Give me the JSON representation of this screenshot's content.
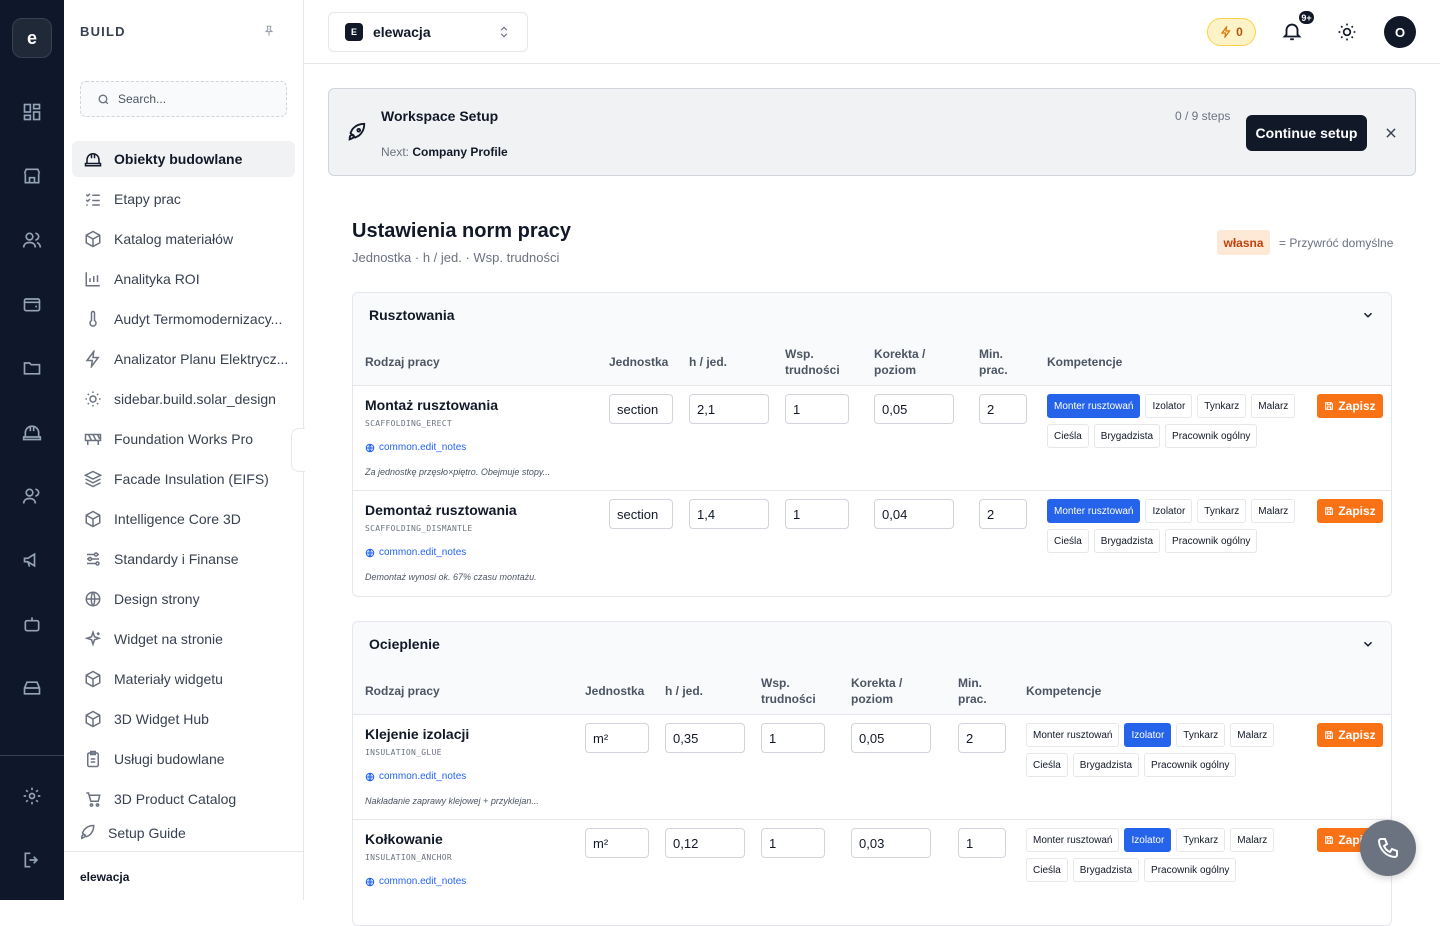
{
  "rail": {
    "logo_letter": "e",
    "icons": [
      "dashboard-icon",
      "store-icon",
      "users-icon",
      "wallet-icon",
      "folder-icon",
      "hardhat-icon",
      "team-icon",
      "megaphone-icon",
      "bot-icon",
      "drive-icon",
      "settings-icon",
      "logout-icon"
    ]
  },
  "sidebar": {
    "title": "BUILD",
    "search_placeholder": "Search...",
    "items": [
      {
        "label": "Obiekty budowlane",
        "icon": "hardhat-icon"
      },
      {
        "label": "Etapy prac",
        "icon": "checklist-icon"
      },
      {
        "label": "Katalog materiałów",
        "icon": "box-icon"
      },
      {
        "label": "Analityka ROI",
        "icon": "bar-chart-icon"
      },
      {
        "label": "Audyt Termomodernizacy...",
        "icon": "thermometer-icon"
      },
      {
        "label": "Analizator Planu Elektrycz...",
        "icon": "zap-icon"
      },
      {
        "label": "sidebar.build.solar_design",
        "icon": "sun-icon"
      },
      {
        "label": "Foundation Works Pro",
        "icon": "construction-icon"
      },
      {
        "label": "Facade Insulation (EIFS)",
        "icon": "layers-icon"
      },
      {
        "label": "Intelligence Core 3D",
        "icon": "box-icon"
      },
      {
        "label": "Standardy i Finanse",
        "icon": "sliders-icon"
      },
      {
        "label": "Design strony",
        "icon": "globe-icon"
      },
      {
        "label": "Widget na stronie",
        "icon": "sparkles-icon"
      },
      {
        "label": "Materiały widgetu",
        "icon": "box-icon"
      },
      {
        "label": "3D Widget Hub",
        "icon": "box-icon"
      },
      {
        "label": "Usługi budowlane",
        "icon": "clipboard-icon"
      },
      {
        "label": "3D Product Catalog",
        "icon": "cart-icon"
      },
      {
        "label": "Setup Guide",
        "icon": "rocket-icon"
      }
    ],
    "workspace": "elewacja"
  },
  "topbar": {
    "workspace_badge": "E",
    "workspace_name": "elewacja",
    "credits": "0",
    "notifications": "9+",
    "avatar": "O"
  },
  "setup": {
    "title": "Workspace Setup",
    "next_label": "Next:",
    "next_value": "Company Profile",
    "steps": "0 / 9 steps",
    "button": "Continue setup"
  },
  "page": {
    "title": "Ustawienia norm pracy",
    "subtitle": "Jednostka · h / jed. · Wsp. trudności",
    "legend_chip": "własna",
    "legend_text": "= Przywróć domyślne"
  },
  "columns": {
    "name": "Rodzaj pracy",
    "unit": "Jednostka",
    "h": "h / jed.",
    "difficulty": [
      "Wsp.",
      "trudności"
    ],
    "correction": [
      "Korekta /",
      "poziom"
    ],
    "min": [
      "Min.",
      "prac."
    ],
    "skills": "Kompetencje"
  },
  "skills": [
    "Monter rusztowań",
    "Izolator",
    "Tynkarz",
    "Malarz",
    "Cieśla",
    "Brygadzista",
    "Pracownik ogólny"
  ],
  "save_label": "Zapisz",
  "notes_link": "common.edit_notes",
  "sections": [
    {
      "title": "Rusztowania",
      "rows": [
        {
          "name": "Montaż rusztowania",
          "code": "SCAFFOLDING_ERECT",
          "unit": "section",
          "h": "2,1",
          "difficulty": "1",
          "correction": "0,05",
          "min": "2",
          "active_skill": "Monter rusztowań",
          "note": "Za jednostkę przęsło×piętro. Obejmuje stopy..."
        },
        {
          "name": "Demontaż rusztowania",
          "code": "SCAFFOLDING_DISMANTLE",
          "unit": "section",
          "h": "1,4",
          "difficulty": "1",
          "correction": "0,04",
          "min": "2",
          "active_skill": "Monter rusztowań",
          "note": "Demontaż wynosi ok. 67% czasu montażu."
        }
      ]
    },
    {
      "title": "Ocieplenie",
      "rows": [
        {
          "name": "Klejenie izolacji",
          "code": "INSULATION_GLUE",
          "unit": "m²",
          "h": "0,35",
          "difficulty": "1",
          "correction": "0,05",
          "min": "2",
          "active_skill": "Izolator",
          "note": "Nakładanie zaprawy klejowej + przyklejan..."
        },
        {
          "name": "Kołkowanie",
          "code": "INSULATION_ANCHOR",
          "unit": "m²",
          "h": "0,12",
          "difficulty": "1",
          "correction": "0,03",
          "min": "1",
          "active_skill": "Izolator",
          "note": ""
        }
      ]
    }
  ],
  "colors": {
    "primary": "#111827",
    "accent_blue": "#2563eb",
    "save_orange": "#f97316",
    "rail": "#0f172a"
  }
}
